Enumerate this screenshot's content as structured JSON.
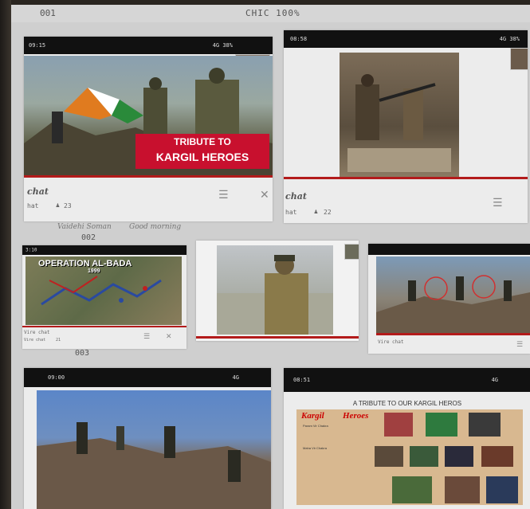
{
  "topbar": {
    "left": "001",
    "center": "CHIC 100%"
  },
  "rows": {
    "label2": "002",
    "label3": "003"
  },
  "card1": {
    "status_time": "09:15",
    "status_right": "4G 38%",
    "banner_line1": "TRIBUTE TO",
    "banner_line2": "KARGIL HEROES",
    "chat_label": "chat",
    "sub_left": "hat",
    "sub_count": "23",
    "message_name": "Vaidehi Soman",
    "message_text": "Good morning"
  },
  "card2": {
    "status_time": "08:58",
    "status_right": "4G 38%",
    "chat_label": "chat",
    "sub_left": "hat",
    "sub_count": "22"
  },
  "card3": {
    "status_time": "3:10",
    "title_line1": "OPERATION AL-BADA",
    "title_line2": "1999",
    "chat_label": "Vire chat",
    "sub_left": "Vire chat",
    "sub_count": "21"
  },
  "card5": {
    "chat_label": "Vire chat"
  },
  "card6": {
    "status_time": "09:00",
    "status_right": "4G"
  },
  "card7": {
    "status_time": "08:51",
    "status_right": "4G",
    "poster_title": "A TRIBUTE TO OUR KARGIL HEROS",
    "poster_kargil": "Kargil",
    "poster_heroes": "Heroes",
    "poster_names1": "Param Vir Chakra",
    "poster_names2": "Maha Vir Chakra"
  },
  "icons": {
    "settings": "settings-icon",
    "close": "close-icon",
    "user": "user-icon"
  },
  "colors": {
    "accent_red": "#b31b1b",
    "status_bar": "#111111"
  }
}
